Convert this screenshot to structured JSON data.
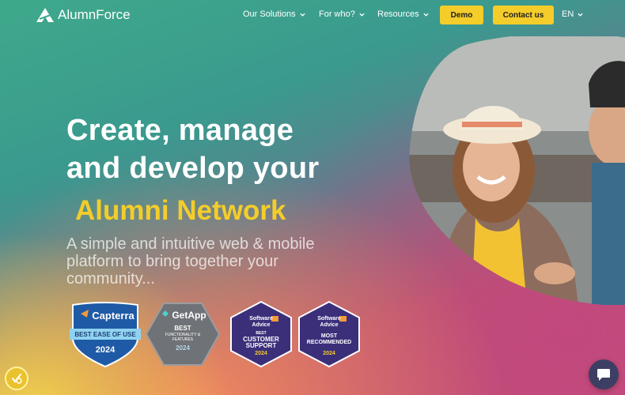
{
  "nav": {
    "logo_text": "AlumnForce",
    "items": [
      {
        "label": "Our Solutions"
      },
      {
        "label": "For who?"
      },
      {
        "label": "Resources"
      }
    ],
    "demo_label": "Demo",
    "contact_label": "Contact us",
    "language": "EN"
  },
  "hero": {
    "title_line1": "Create, manage",
    "title_line2": "and develop your",
    "title_accent": "Alumni Network",
    "subtitle": "A simple and intuitive web & mobile platform to bring together your community..."
  },
  "badges": [
    {
      "brand": "Capterra",
      "title": "BEST EASE OF USE",
      "year": "2024",
      "color": "#1f5aa6"
    },
    {
      "brand": "GetApp",
      "title": "BEST",
      "subtitle": "FUNCTIONALITY & FEATURES",
      "year": "2024",
      "color": "#6f7276"
    },
    {
      "brand_line1": "Software",
      "brand_line2": "Advice",
      "title_line1": "BEST",
      "title_line2": "CUSTOMER",
      "title_line3": "SUPPORT",
      "year": "2024",
      "color": "#3c2f7a"
    },
    {
      "brand_line1": "Software",
      "brand_line2": "Advice",
      "title_line1": "MOST",
      "title_line2": "RECOMMENDED",
      "year": "2024",
      "color": "#3c2f7a"
    }
  ],
  "colors": {
    "accent_yellow": "#f4cd2a",
    "chat_bg": "#3c3f63"
  }
}
